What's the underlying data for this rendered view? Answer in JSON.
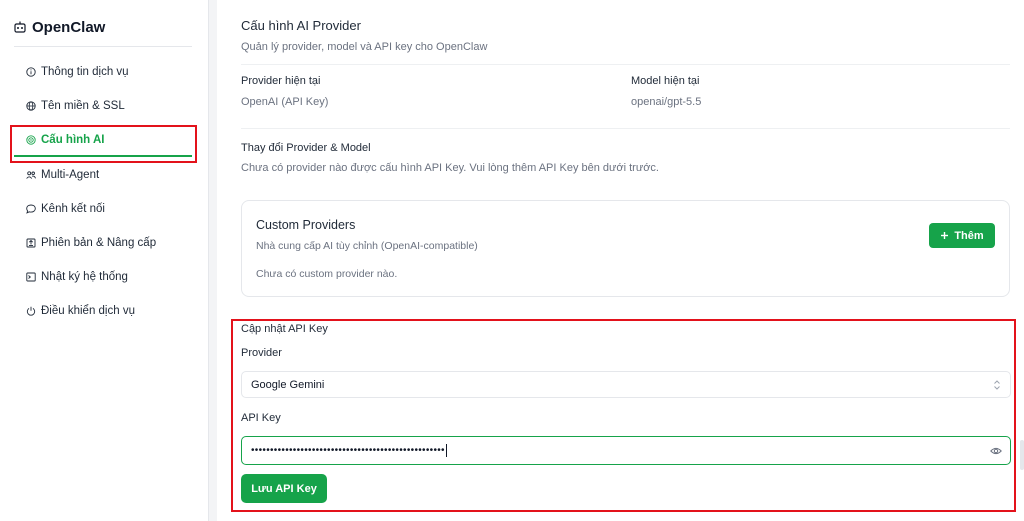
{
  "sidebar": {
    "brand": "OpenClaw",
    "items": [
      {
        "label": "Thông tin dịch vụ",
        "icon": "info-icon"
      },
      {
        "label": "Tên miền & SSL",
        "icon": "globe-icon"
      },
      {
        "label": "Cấu hình AI",
        "icon": "ai-icon",
        "active": true
      },
      {
        "label": "Multi-Agent",
        "icon": "users-icon"
      },
      {
        "label": "Kênh kết nối",
        "icon": "chat-icon"
      },
      {
        "label": "Phiên bản & Nâng cấp",
        "icon": "package-icon"
      },
      {
        "label": "Nhật ký hệ thống",
        "icon": "terminal-icon"
      },
      {
        "label": "Điều khiển dịch vụ",
        "icon": "power-icon"
      }
    ]
  },
  "main": {
    "title": "Cấu hình AI Provider",
    "subtitle": "Quản lý provider, model và API key cho OpenClaw",
    "current_provider_label": "Provider hiện tại",
    "current_provider_value": "OpenAI (API Key)",
    "current_model_label": "Model hiện tại",
    "current_model_value": "openai/gpt-5.5",
    "change_title": "Thay đổi Provider & Model",
    "change_desc": "Chưa có provider nào được cấu hình API Key. Vui lòng thêm API Key bên dưới trước.",
    "custom": {
      "title": "Custom Providers",
      "desc": "Nhà cung cấp AI tùy chỉnh (OpenAI-compatible)",
      "empty": "Chưa có custom provider nào.",
      "add_label": "Thêm"
    },
    "update": {
      "title": "Cập nhật API Key",
      "provider_label": "Provider",
      "provider_value": "Google Gemini",
      "api_key_label": "API Key",
      "api_key_value": "•••••••••••••••••••••••••••••••••••••••••••••••••••",
      "save_label": "Lưu API Key"
    }
  },
  "colors": {
    "accent": "#16a34a",
    "annotation": "#e3121b"
  }
}
